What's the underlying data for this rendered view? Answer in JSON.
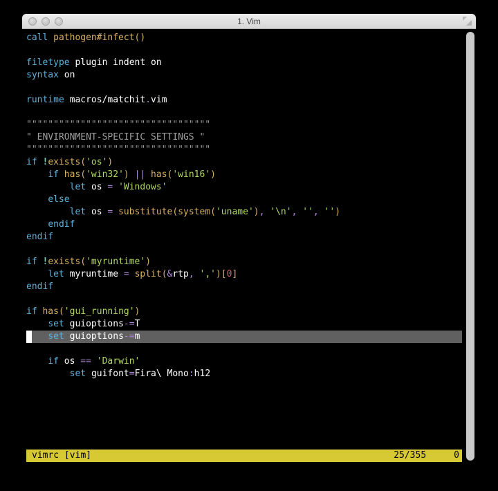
{
  "window": {
    "title": "1. Vim"
  },
  "status": {
    "filename": "vimrc [vim]",
    "position": "25/355",
    "col": "0"
  },
  "cursor": {
    "line_index": 24
  },
  "lines": [
    [
      [
        "kw",
        "call"
      ],
      [
        "id",
        " "
      ],
      [
        "func",
        "pathogen#infect"
      ],
      [
        "br",
        "()"
      ]
    ],
    [],
    [
      [
        "kw",
        "filetype"
      ],
      [
        "id",
        " "
      ],
      [
        "wht",
        "plugin indent on"
      ]
    ],
    [
      [
        "kw",
        "syntax"
      ],
      [
        "id",
        " "
      ],
      [
        "wht",
        "on"
      ]
    ],
    [],
    [
      [
        "kw",
        "runtime"
      ],
      [
        "id",
        " "
      ],
      [
        "wht",
        "macros/matchit"
      ],
      [
        "op",
        "."
      ],
      [
        "wht",
        "vim"
      ]
    ],
    [],
    [
      [
        "dim",
        "\"\"\"\"\"\"\"\"\"\"\"\"\"\"\"\"\"\"\"\"\"\"\"\"\"\"\"\"\"\"\"\"\"\""
      ]
    ],
    [
      [
        "dim",
        "\" ENVIRONMENT-SPECIFIC SETTINGS \""
      ]
    ],
    [
      [
        "dim",
        "\"\"\"\"\"\"\"\"\"\"\"\"\"\"\"\"\"\"\"\"\"\"\"\"\"\"\"\"\"\"\"\"\"\""
      ]
    ],
    [
      [
        "kw",
        "if"
      ],
      [
        "id",
        " "
      ],
      [
        "sym",
        "!"
      ],
      [
        "func",
        "exists"
      ],
      [
        "br",
        "("
      ],
      [
        "str",
        "'os'"
      ],
      [
        "br",
        ")"
      ]
    ],
    [
      [
        "id",
        "    "
      ],
      [
        "kw",
        "if"
      ],
      [
        "id",
        " "
      ],
      [
        "func",
        "has"
      ],
      [
        "br",
        "("
      ],
      [
        "str",
        "'win32'"
      ],
      [
        "br",
        ")"
      ],
      [
        "id",
        " "
      ],
      [
        "op",
        "||"
      ],
      [
        "id",
        " "
      ],
      [
        "func",
        "has"
      ],
      [
        "br",
        "("
      ],
      [
        "str",
        "'win16'"
      ],
      [
        "br",
        ")"
      ]
    ],
    [
      [
        "id",
        "        "
      ],
      [
        "kw",
        "let"
      ],
      [
        "id",
        " "
      ],
      [
        "wht",
        "os"
      ],
      [
        "id",
        " "
      ],
      [
        "op",
        "="
      ],
      [
        "id",
        " "
      ],
      [
        "str",
        "'Windows'"
      ]
    ],
    [
      [
        "id",
        "    "
      ],
      [
        "kw",
        "else"
      ]
    ],
    [
      [
        "id",
        "        "
      ],
      [
        "kw",
        "let"
      ],
      [
        "id",
        " "
      ],
      [
        "wht",
        "os"
      ],
      [
        "id",
        " "
      ],
      [
        "op",
        "="
      ],
      [
        "id",
        " "
      ],
      [
        "func",
        "substitute"
      ],
      [
        "br",
        "("
      ],
      [
        "func",
        "system"
      ],
      [
        "br",
        "("
      ],
      [
        "str",
        "'uname'"
      ],
      [
        "br",
        ")"
      ],
      [
        "op",
        ","
      ],
      [
        "id",
        " "
      ],
      [
        "str",
        "'\\n'"
      ],
      [
        "op",
        ","
      ],
      [
        "id",
        " "
      ],
      [
        "str",
        "''"
      ],
      [
        "op",
        ","
      ],
      [
        "id",
        " "
      ],
      [
        "str",
        "''"
      ],
      [
        "br",
        ")"
      ]
    ],
    [
      [
        "id",
        "    "
      ],
      [
        "kw",
        "endif"
      ]
    ],
    [
      [
        "kw",
        "endif"
      ]
    ],
    [],
    [
      [
        "kw",
        "if"
      ],
      [
        "id",
        " "
      ],
      [
        "sym",
        "!"
      ],
      [
        "func",
        "exists"
      ],
      [
        "br",
        "("
      ],
      [
        "str",
        "'myruntime'"
      ],
      [
        "br",
        ")"
      ]
    ],
    [
      [
        "id",
        "    "
      ],
      [
        "kw",
        "let"
      ],
      [
        "id",
        " "
      ],
      [
        "wht",
        "myruntime"
      ],
      [
        "id",
        " "
      ],
      [
        "op",
        "="
      ],
      [
        "id",
        " "
      ],
      [
        "func",
        "split"
      ],
      [
        "br",
        "("
      ],
      [
        "op",
        "&"
      ],
      [
        "wht",
        "rtp"
      ],
      [
        "op",
        ","
      ],
      [
        "id",
        " "
      ],
      [
        "str",
        "','"
      ],
      [
        "br",
        ")["
      ],
      [
        "num",
        "0"
      ],
      [
        "br",
        "]"
      ]
    ],
    [
      [
        "kw",
        "endif"
      ]
    ],
    [],
    [
      [
        "kw",
        "if"
      ],
      [
        "id",
        " "
      ],
      [
        "func",
        "has"
      ],
      [
        "br",
        "("
      ],
      [
        "str",
        "'gui_running'"
      ],
      [
        "br",
        ")"
      ]
    ],
    [
      [
        "id",
        "    "
      ],
      [
        "kw",
        "set"
      ],
      [
        "id",
        " "
      ],
      [
        "wht",
        "guioptions"
      ],
      [
        "op",
        "-="
      ],
      [
        "wht",
        "T"
      ]
    ],
    [
      [
        "id",
        "    "
      ],
      [
        "kw",
        "set"
      ],
      [
        "id",
        " "
      ],
      [
        "wht",
        "guioptions"
      ],
      [
        "op",
        "-="
      ],
      [
        "wht",
        "m"
      ]
    ],
    [],
    [
      [
        "id",
        "    "
      ],
      [
        "kw",
        "if"
      ],
      [
        "id",
        " "
      ],
      [
        "wht",
        "os"
      ],
      [
        "id",
        " "
      ],
      [
        "op",
        "=="
      ],
      [
        "id",
        " "
      ],
      [
        "str",
        "'Darwin'"
      ]
    ],
    [
      [
        "id",
        "        "
      ],
      [
        "kw",
        "set"
      ],
      [
        "id",
        " "
      ],
      [
        "wht",
        "guifont"
      ],
      [
        "op",
        "="
      ],
      [
        "wht",
        "Fira\\ Mono"
      ],
      [
        "op",
        ":"
      ],
      [
        "wht",
        "h12"
      ]
    ]
  ]
}
